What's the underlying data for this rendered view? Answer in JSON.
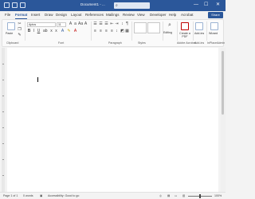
{
  "title_bar": {
    "doc_title": "Document1 - ...",
    "search_glyph": "⌕",
    "minimize": "—",
    "maximize": "☐",
    "close": "✕"
  },
  "tabs": [
    "File",
    "Format",
    "Insert",
    "Draw",
    "Design",
    "Layout",
    "References",
    "Mailings",
    "Review",
    "View",
    "Developer",
    "Help",
    "Acrobat"
  ],
  "active_tab": "Format",
  "share_label": "Share",
  "ribbon": {
    "clipboard": {
      "paste_label": "Paste",
      "group": "Clipboard"
    },
    "font": {
      "family": "Aptos",
      "size": "11",
      "group": "Font"
    },
    "paragraph": {
      "group": "Paragraph"
    },
    "styles": {
      "group": "Styles"
    },
    "editing": {
      "label": "Editing",
      "group": ""
    },
    "adobe": {
      "label": "Create a PDF",
      "group": "Adobe Acrobat"
    },
    "addins": {
      "label": "Add-ins",
      "group": "Add-ins"
    },
    "wizard": {
      "label": "Wizard",
      "group": "InPlaceAdmin"
    }
  },
  "statusbar": {
    "page": "Page 1 of 1",
    "words": "0 words",
    "accessibility": "Accessibility: Good to go",
    "zoom": "100%"
  },
  "colors": {
    "accent": "#2b579a",
    "ribbon_bg": "#fafafa",
    "page_bg": "#ffffff"
  }
}
